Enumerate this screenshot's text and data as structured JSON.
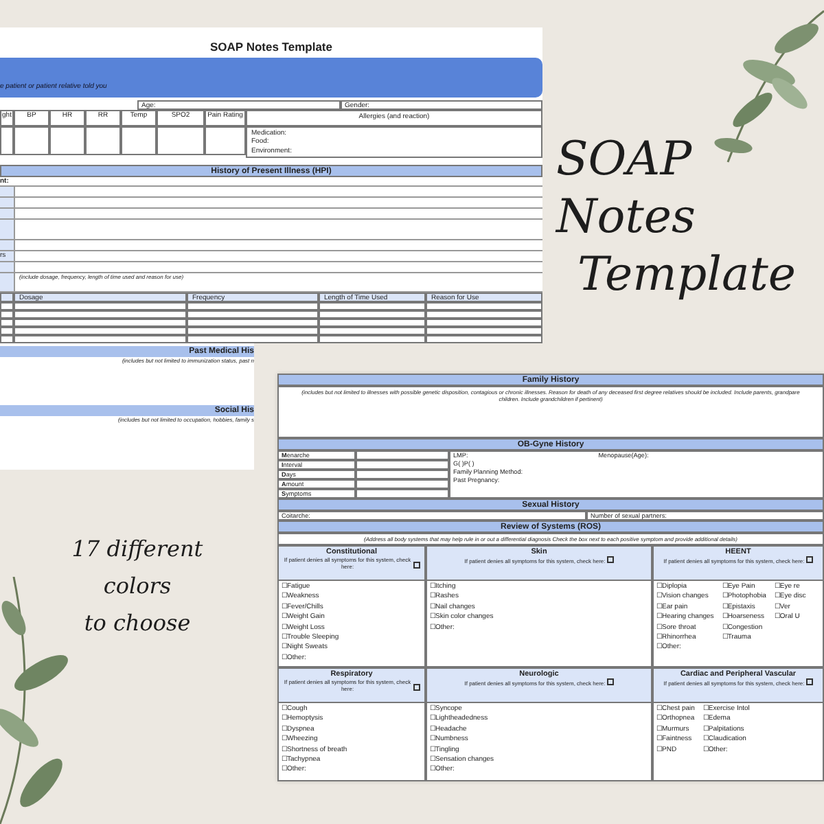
{
  "sheet_top": {
    "title": "SOAP Notes Template",
    "banner_text": "e patient or patient relative told you",
    "age_label": "Age:",
    "gender_label": "Gender:",
    "vitals_columns": [
      "ght",
      "BP",
      "HR",
      "RR",
      "Temp",
      "SPO2",
      "Pain Rating"
    ],
    "allergies_heading": "Allergies (and reaction)",
    "allergy_lines": [
      "Medication:",
      "Food:",
      "Environment:"
    ],
    "hpi_heading": "History of Present Illness (HPI)",
    "hpi_first_label": "nt:",
    "hpi_other_label": "rs",
    "medication_note": "(include dosage, frequency, length of time used and reason for use)",
    "medication_columns": [
      "Dosage",
      "Frequency",
      "Length of Time Used",
      "Reason for Use"
    ],
    "sections": [
      {
        "heading": "Past Medical His",
        "note": "(includes but not limited to immunization status, past n"
      },
      {
        "heading": "Social His",
        "note": "(includes but not limited to occupation, hobbies, family s"
      }
    ]
  },
  "promo_title_lines": [
    "SOAP Notes",
    "Template"
  ],
  "promo_colors_lines": [
    "17 different",
    "colors",
    "to choose"
  ],
  "sheet_bottom": {
    "family_heading": "Family History",
    "family_note_lines": [
      "(includes but not limited to illnesses with possible genetic disposition, contagious or chronic illnesses. Reason for death of any deceased first degree relatives should be included. Include parents, grandpare",
      "children. Include grandchildren if pertinent)"
    ],
    "obgyn_heading": "OB-Gyne History",
    "obgyn_labels": [
      "**M**enarche",
      "**I**nterval",
      "**D**ays",
      "**A**mount",
      "**S**ymptoms"
    ],
    "lmp_label": "LMP:",
    "menopause_label": "Menopause(Age):",
    "obgyn_lines": [
      "G( )P( )",
      "Family Planning Method:",
      "Past Pregnancy:"
    ],
    "sexual_heading": "Sexual History",
    "coitarche_label": "Coitarche:",
    "partners_label": "Number of sexual partners:",
    "ros_heading": "Review of Systems (ROS)",
    "ros_note": "(Address all body systems that may help rule in or out a differential diagnosis Check the box next to each positive symptom and provide additional details)",
    "systems": [
      {
        "name": "Constitutional",
        "deny_note": "If patient denies all symptoms for this system, check here:",
        "deny_checked": false,
        "columns": [
          [
            "☐Fatigue",
            "☐Weakness",
            "☐Fever/Chills",
            "☐Weight Gain",
            "☐Weight Loss",
            "☐Trouble Sleeping",
            "☐Night Sweats",
            "☐Other:"
          ]
        ]
      },
      {
        "name": "Skin",
        "deny_note": "If patient denies all symptoms for this system, check here:",
        "deny_checked": false,
        "columns": [
          [
            "☐Itching",
            "☐Rashes",
            "☐Nail changes",
            "☐Skin color changes",
            "☐Other:"
          ]
        ]
      },
      {
        "name": "HEENT",
        "deny_note": "If patient denies all symptoms for this system, check here:",
        "deny_checked": false,
        "columns": [
          [
            "☐Diplopia",
            "☐Vision changes",
            "☐Ear pain",
            "☐Hearing changes",
            "☐Sore throat",
            "☐Rhinorrhea",
            "☐Other:"
          ],
          [
            "☐Eye Pain",
            "☐Photophobia",
            "☐Epistaxis",
            "☐Hoarseness",
            "☐Congestion",
            "☐Trauma"
          ],
          [
            "☐Eye re",
            "☐Eye disc",
            "☐Ver",
            "☐Oral U"
          ]
        ]
      },
      {
        "name": "Respiratory",
        "deny_note": "If patient denies all symptoms for this system, check here:",
        "deny_checked": false,
        "columns": [
          [
            "☐Cough",
            "☐Hemoptysis",
            "☐Dyspnea",
            "☐Wheezing",
            "☐Shortness of breath",
            "☐Tachypnea",
            "☐Other:"
          ]
        ]
      },
      {
        "name": "Neurologic",
        "deny_note": "If patient denies all symptoms for this system, check here:",
        "deny_checked": false,
        "columns": [
          [
            "☐Syncope",
            "☐Lightheadedness",
            "☐Headache",
            "☐Numbness",
            "☐Tingling",
            "☐Sensation changes",
            "☐Other:"
          ]
        ]
      },
      {
        "name": "Cardiac and Peripheral Vascular",
        "deny_note": "If patient denies all symptoms for this system, check here:",
        "deny_checked": false,
        "columns": [
          [
            "☐Chest pain",
            "☐Orthopnea",
            "☐Murmurs",
            "☐Faintness",
            "☐PND"
          ],
          [
            "☐Exercise Intol",
            "☐Edema",
            "☐Palpitations",
            "☐Claudication",
            "☐Other:"
          ]
        ]
      }
    ]
  }
}
